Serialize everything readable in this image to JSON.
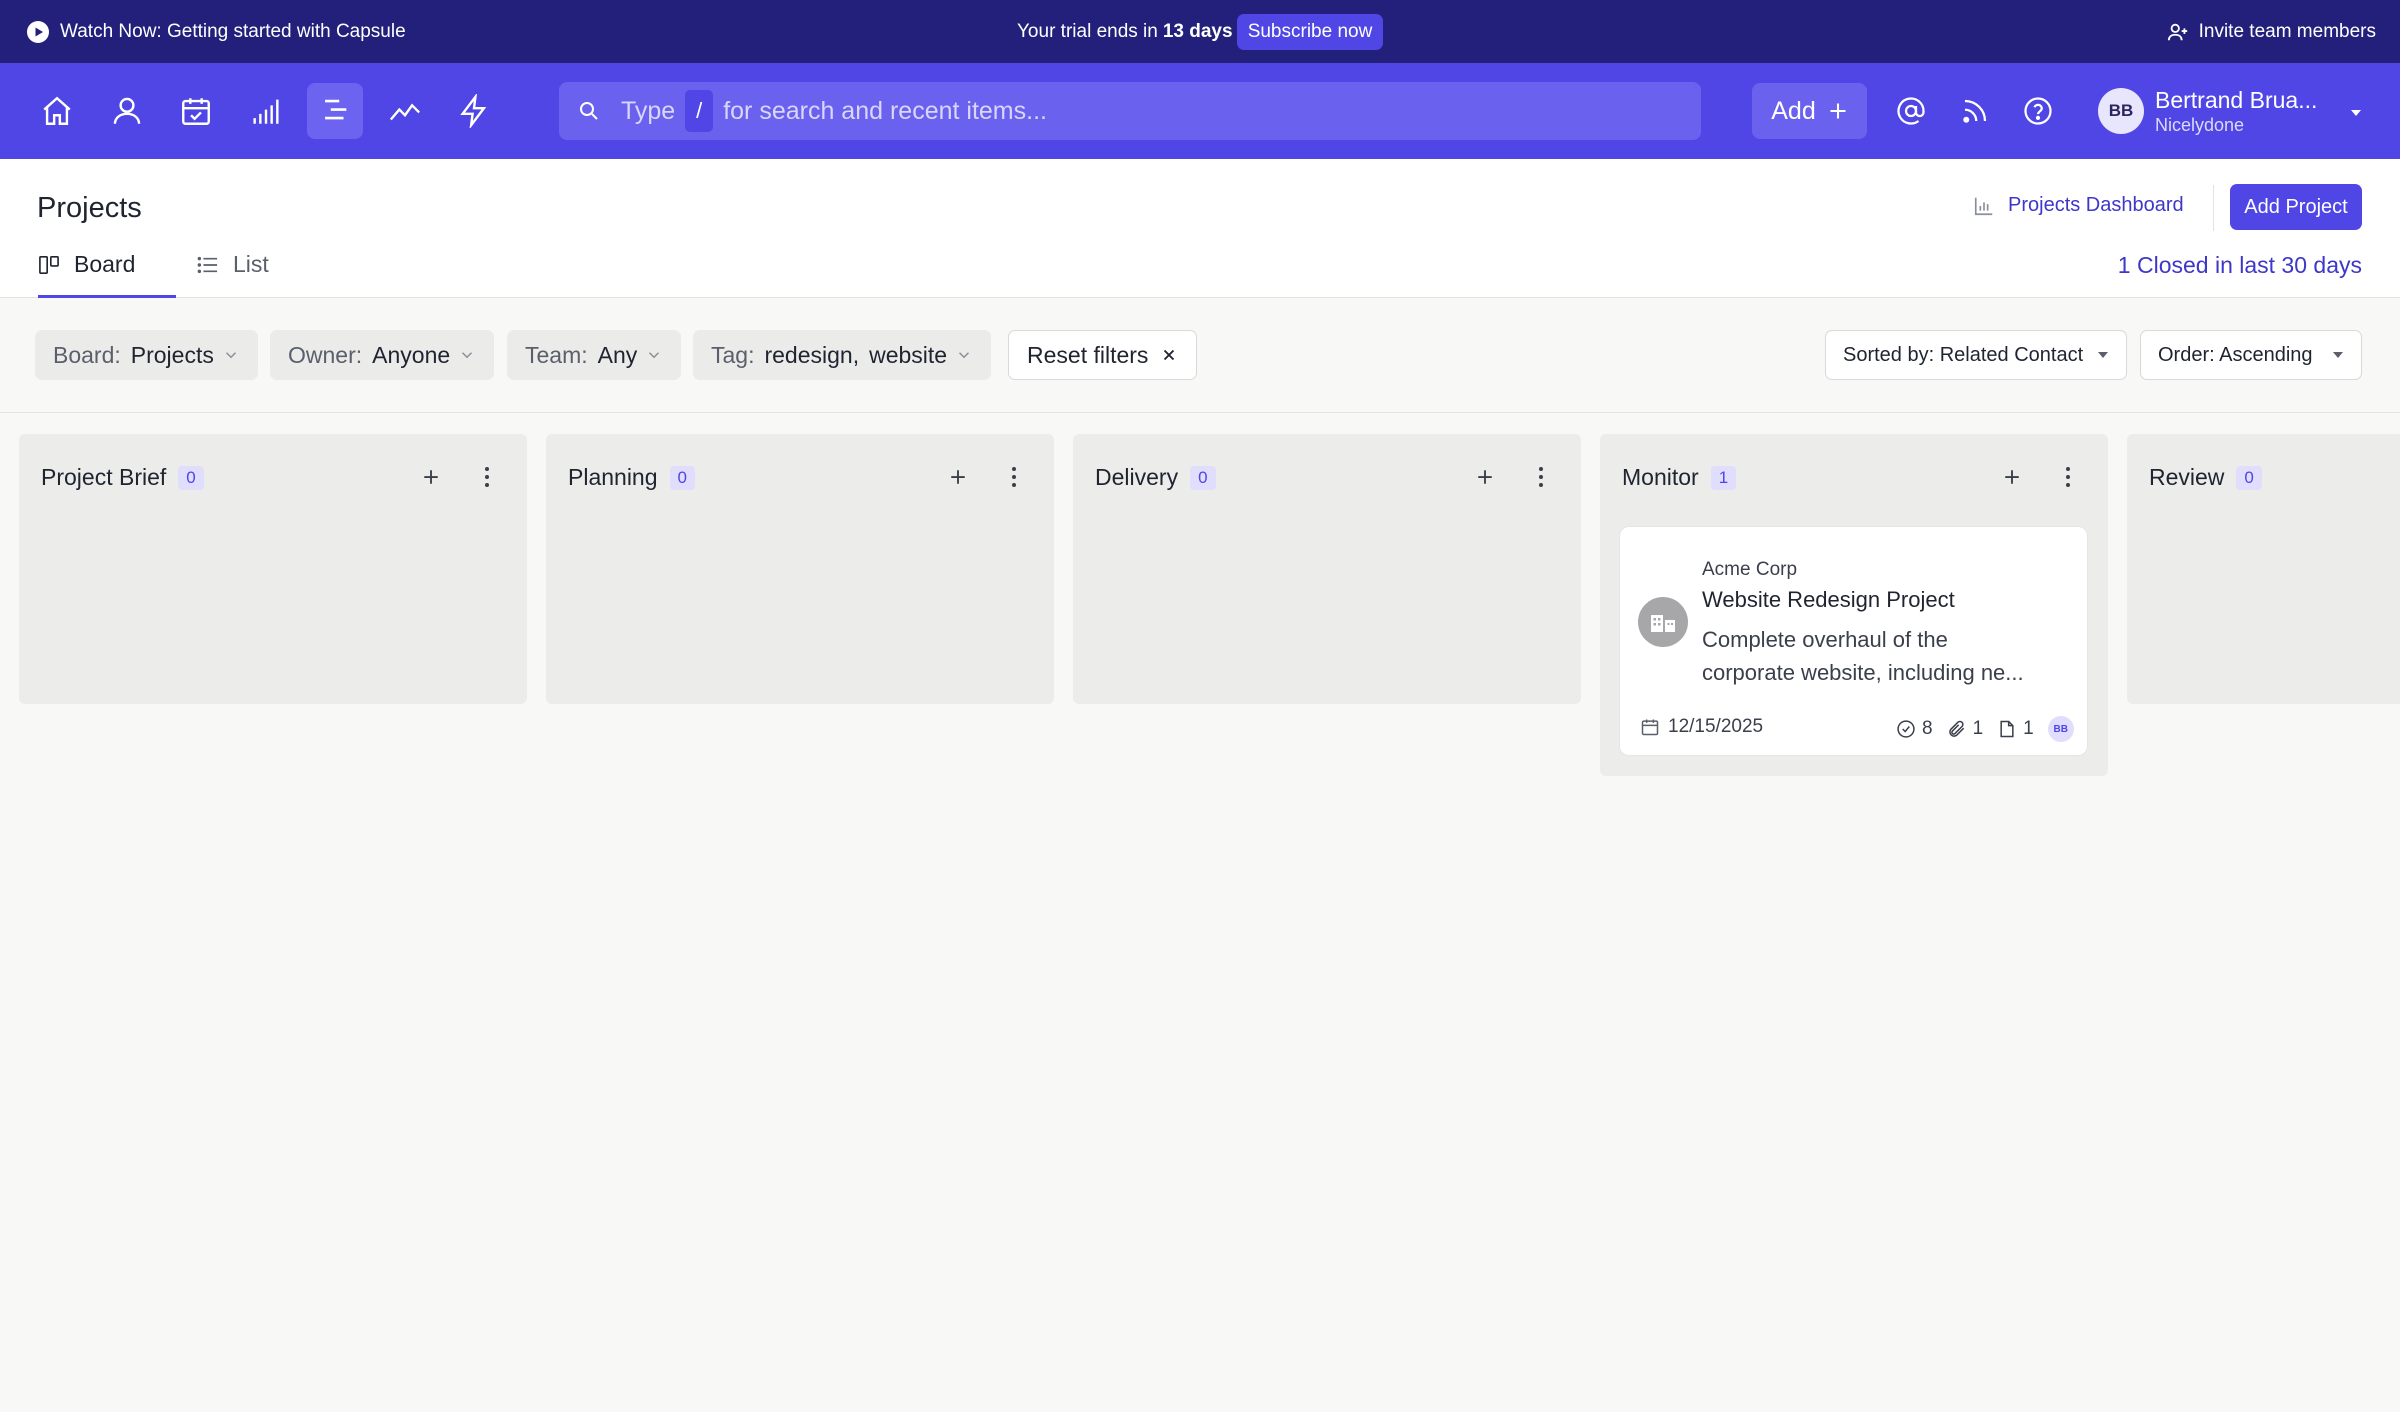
{
  "announcement": {
    "watch_text": "Watch Now: Getting started with Capsule",
    "trial_prefix": "Your trial ends in",
    "trial_days": "13 days",
    "subscribe_label": "Subscribe now",
    "invite_label": "Invite team members"
  },
  "nav": {
    "icons": [
      "home-icon",
      "person-icon",
      "calendar-check-icon",
      "bar-chart-icon",
      "projects-icon",
      "trend-icon",
      "lightning-icon"
    ],
    "active": "projects-icon",
    "search": {
      "word": "Type",
      "shortcut": "/",
      "placeholder": "for search and recent items..."
    },
    "add_label": "Add",
    "user": {
      "initials": "BB",
      "name": "Bertrand Brua...",
      "org": "Nicelydone"
    }
  },
  "page": {
    "title": "Projects",
    "dashboard_link": "Projects Dashboard",
    "add_project": "Add Project",
    "tabs": [
      {
        "label": "Board",
        "active": true
      },
      {
        "label": "List",
        "active": false
      }
    ],
    "closed_link": "1 Closed in last 30 days"
  },
  "filters": {
    "board": {
      "label": "Board:",
      "value": "Projects"
    },
    "owner": {
      "label": "Owner:",
      "value": "Anyone"
    },
    "team": {
      "label": "Team:",
      "value": "Any"
    },
    "tag": {
      "label": "Tag:",
      "value1": "redesign,",
      "value2": "website"
    },
    "reset": "Reset filters",
    "sorted_by": "Sorted by: Related Contact",
    "order": "Order: Ascending"
  },
  "columns": [
    {
      "name": "Project Brief",
      "count": "0"
    },
    {
      "name": "Planning",
      "count": "0"
    },
    {
      "name": "Delivery",
      "count": "0"
    },
    {
      "name": "Monitor",
      "count": "1"
    },
    {
      "name": "Review",
      "count": "0"
    }
  ],
  "card": {
    "organization": "Acme Corp",
    "title": "Website Redesign Project",
    "description_line1": "Complete overhaul of the",
    "description_line2": "corporate website, including ne...",
    "date": "12/15/2025",
    "tasks": "8",
    "attachments": "1",
    "files": "1",
    "owner_initials": "BB"
  },
  "colors": {
    "announcement_bg": "#23207b",
    "nav_bg": "#5046e5",
    "accent": "#4f46e5",
    "column_bg": "#ececeb"
  }
}
